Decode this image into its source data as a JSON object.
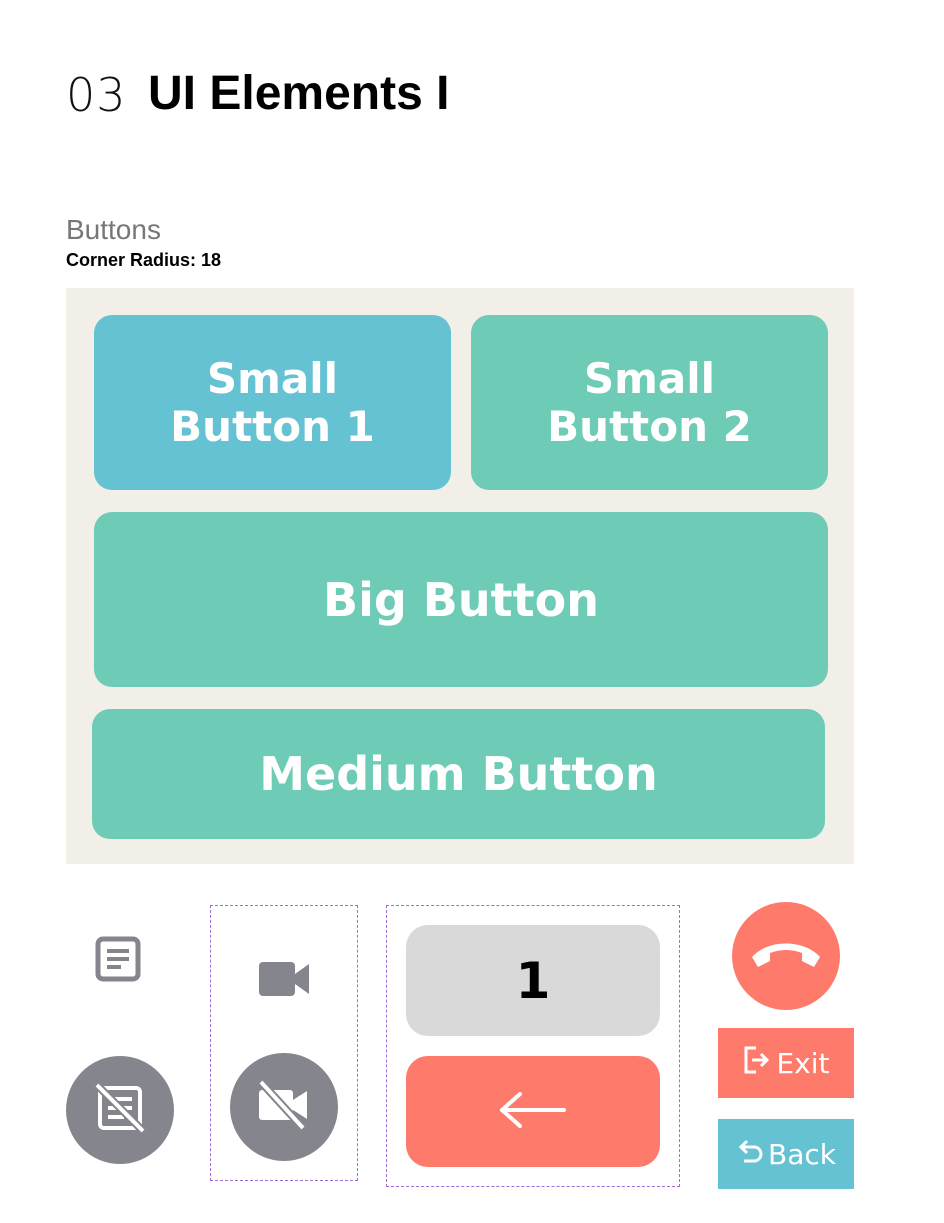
{
  "header": {
    "number": "03",
    "title": "UI Elements I"
  },
  "section": {
    "label": "Buttons",
    "subtitle": "Corner Radius: 18"
  },
  "buttons": {
    "small1_line1": "Small",
    "small1_line2": "Button 1",
    "small2_line1": "Small",
    "small2_line2": "Button 2",
    "big": "Big Button",
    "medium": "Medium Button"
  },
  "keypad": {
    "number": "1"
  },
  "actions": {
    "exit": "Exit",
    "back": "Back"
  },
  "colors": {
    "blue": "#64c2d3",
    "teal": "#6dcbb6",
    "coral": "#fe7b6c",
    "gray_circle": "#85868d",
    "panel_bg": "#f2efe8",
    "key_gray": "#d9d9d9"
  },
  "icons": [
    "document-icon",
    "document-off-icon",
    "video-camera-icon",
    "video-camera-off-icon",
    "arrow-left-icon",
    "phone-hangup-icon",
    "exit-icon",
    "undo-icon"
  ]
}
